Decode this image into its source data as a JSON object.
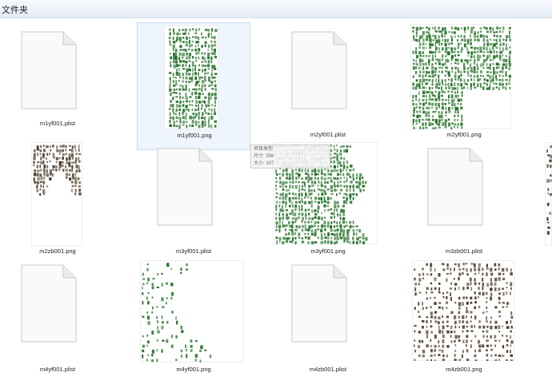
{
  "header": {
    "title": "文件夹"
  },
  "files": [
    {
      "name": "m1yf001.plist",
      "kind": "plist"
    },
    {
      "name": "m1yf001.png",
      "kind": "png",
      "theme": "green-tall",
      "selected": true
    },
    {
      "name": "m2yf001.plist",
      "kind": "plist"
    },
    {
      "name": "m2yf001.png",
      "kind": "png",
      "theme": "green-wide"
    },
    {
      "name": "m2zb001.png",
      "kind": "png",
      "theme": "brown-tall"
    },
    {
      "name": "m3yf001.plist",
      "kind": "plist"
    },
    {
      "name": "m3yf001.png",
      "kind": "png",
      "theme": "green-right"
    },
    {
      "name": "m3zb001.plist",
      "kind": "plist"
    },
    {
      "name": "m4yf001.plist",
      "kind": "plist"
    },
    {
      "name": "m4yf001.png",
      "kind": "png",
      "theme": "green-sparse"
    },
    {
      "name": "m4zb001.plist",
      "kind": "plist"
    },
    {
      "name": "m4zb001.png",
      "kind": "png",
      "theme": "brown-wide"
    }
  ],
  "tooltip": {
    "line1": "项目类型: ",
    "line2": "尺寸: 256",
    "line3": "大小: 107"
  },
  "colors": {
    "green": "#1f6e22",
    "brown": "#4a3a26",
    "selection_bg": "#eef5fd"
  }
}
